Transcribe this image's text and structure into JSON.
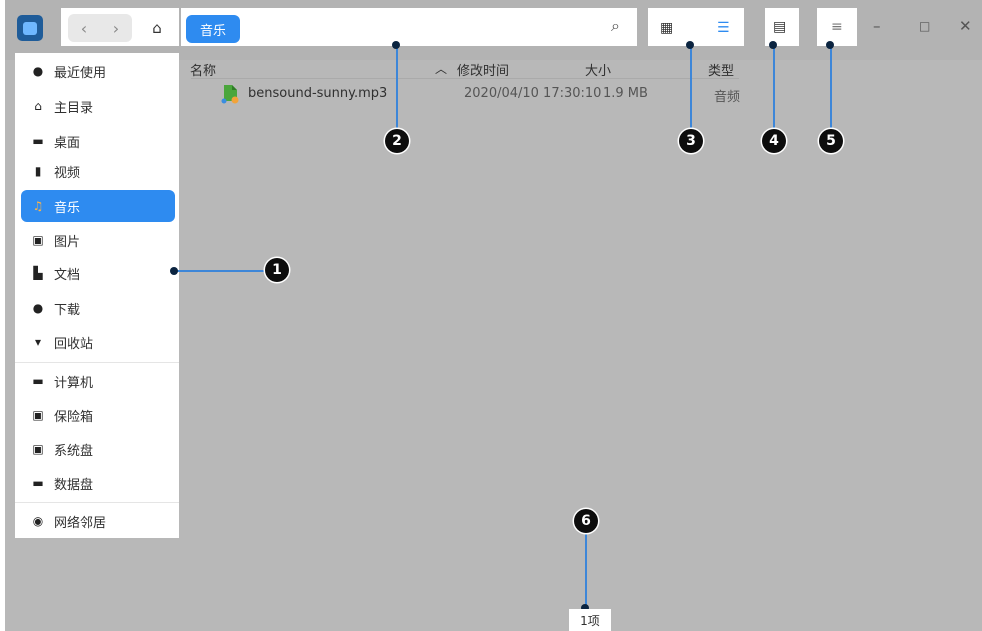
{
  "toolbar": {
    "back_icon": "chevron-left-icon",
    "forward_icon": "chevron-right-icon",
    "home_icon": "home-icon",
    "breadcrumb": "音乐",
    "search_icon": "search-icon",
    "icon_view_icon": "grid-icon",
    "list_view_icon": "list-icon",
    "detail_icon": "detail-panel-icon",
    "menu_icon": "menu-icon",
    "accent": "#2e8bf0"
  },
  "sidebar": {
    "items": [
      {
        "label": "最近使用",
        "icon": "clock-icon"
      },
      {
        "label": "主目录",
        "icon": "home-icon"
      },
      {
        "label": "桌面",
        "icon": "desktop-icon"
      },
      {
        "label": "视频",
        "icon": "video-icon"
      },
      {
        "label": "音乐",
        "icon": "music-icon",
        "active": true
      },
      {
        "label": "图片",
        "icon": "picture-icon"
      },
      {
        "label": "文档",
        "icon": "document-icon"
      },
      {
        "label": "下载",
        "icon": "download-icon"
      },
      {
        "label": "回收站",
        "icon": "trash-icon"
      },
      {
        "label": "计算机",
        "icon": "computer-icon"
      },
      {
        "label": "保险箱",
        "icon": "vault-icon"
      },
      {
        "label": "系统盘",
        "icon": "system-disk-icon"
      },
      {
        "label": "数据盘",
        "icon": "data-disk-icon"
      },
      {
        "label": "网络邻居",
        "icon": "network-icon"
      }
    ]
  },
  "table": {
    "columns": [
      "名称",
      "修改时间",
      "大小",
      "类型"
    ],
    "rows": [
      {
        "name": "bensound-sunny.mp3",
        "modified": "2020/04/10 17:30:10",
        "size": "1.9 MB",
        "type": "音频",
        "icon": "music-file-icon"
      }
    ]
  },
  "callouts": [
    "1",
    "2",
    "3",
    "4",
    "5",
    "6"
  ],
  "status": {
    "count": "1项"
  }
}
